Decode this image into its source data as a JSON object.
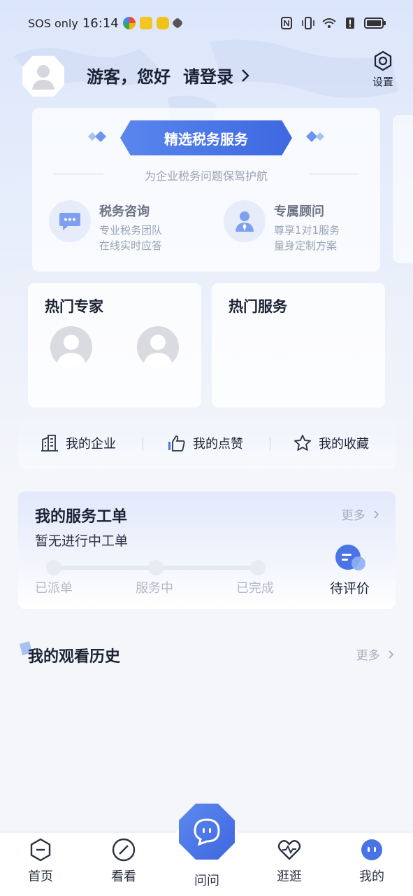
{
  "status_bar": {
    "carrier": "SOS only",
    "time": "16:14"
  },
  "header": {
    "login_prompt": "游客，您好",
    "login_action": "请登录",
    "settings_label": "设置"
  },
  "service_card": {
    "banner": "精选税务服务",
    "subtitle": "为企业税务问题保驾护航",
    "items": [
      {
        "title": "税务咨询",
        "line1": "专业税务团队",
        "line2": "在线实时应答",
        "icon": "chat-bubble-icon"
      },
      {
        "title": "专属顾问",
        "line1": "尊享1对1服务",
        "line2": "量身定制方案",
        "icon": "advisor-icon"
      }
    ]
  },
  "hot": {
    "experts_title": "热门专家",
    "services_title": "热门服务"
  },
  "quick_links": [
    {
      "label": "我的企业",
      "icon": "building-icon"
    },
    {
      "label": "我的点赞",
      "icon": "thumbs-up-icon"
    },
    {
      "label": "我的收藏",
      "icon": "star-icon"
    }
  ],
  "work_orders": {
    "title": "我的服务工单",
    "more": "更多",
    "empty": "暂无进行中工单",
    "steps": [
      "已派单",
      "服务中",
      "已完成"
    ],
    "evaluate": "待评价"
  },
  "history": {
    "title": "我的观看历史",
    "more": "更多"
  },
  "nav": {
    "items": [
      {
        "label": "首页",
        "icon": "home-icon"
      },
      {
        "label": "看看",
        "icon": "compass-icon"
      },
      {
        "label": "问问",
        "icon": "chat-icon"
      },
      {
        "label": "逛逛",
        "icon": "heart-pulse-icon"
      },
      {
        "label": "我的",
        "icon": "profile-icon"
      }
    ],
    "active_color": "#4a73e6"
  },
  "colors": {
    "accent": "#4a73e6",
    "background": "#f4f6fa"
  }
}
